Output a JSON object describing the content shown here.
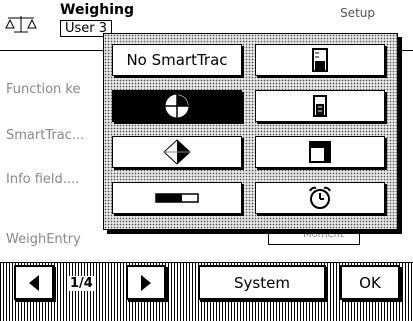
{
  "header": {
    "title": "Weighing",
    "subtitle": "User 3",
    "right_label": "Setup"
  },
  "background_list": {
    "items": [
      {
        "label": "Function ke"
      },
      {
        "label": "SmartTrac..."
      },
      {
        "label": "Info field...."
      },
      {
        "label": "WeighEntry"
      }
    ],
    "info_field_value": "Moment"
  },
  "popup": {
    "options": [
      {
        "label": "No SmartTrac",
        "icon": null,
        "selected": false
      },
      {
        "label": "",
        "icon": "cylinder-icon",
        "selected": false
      },
      {
        "label": "",
        "icon": "circle-quadrant-icon",
        "selected": true
      },
      {
        "label": "",
        "icon": "beaker-icon",
        "selected": false
      },
      {
        "label": "",
        "icon": "diamond-split-icon",
        "selected": false
      },
      {
        "label": "",
        "icon": "square-fill-icon",
        "selected": false
      },
      {
        "label": "",
        "icon": "horizontal-bar-icon",
        "selected": false
      },
      {
        "label": "",
        "icon": "alarm-clock-icon",
        "selected": false
      }
    ]
  },
  "footer": {
    "page_indicator": "1/4",
    "system_label": "System",
    "ok_label": "OK"
  }
}
